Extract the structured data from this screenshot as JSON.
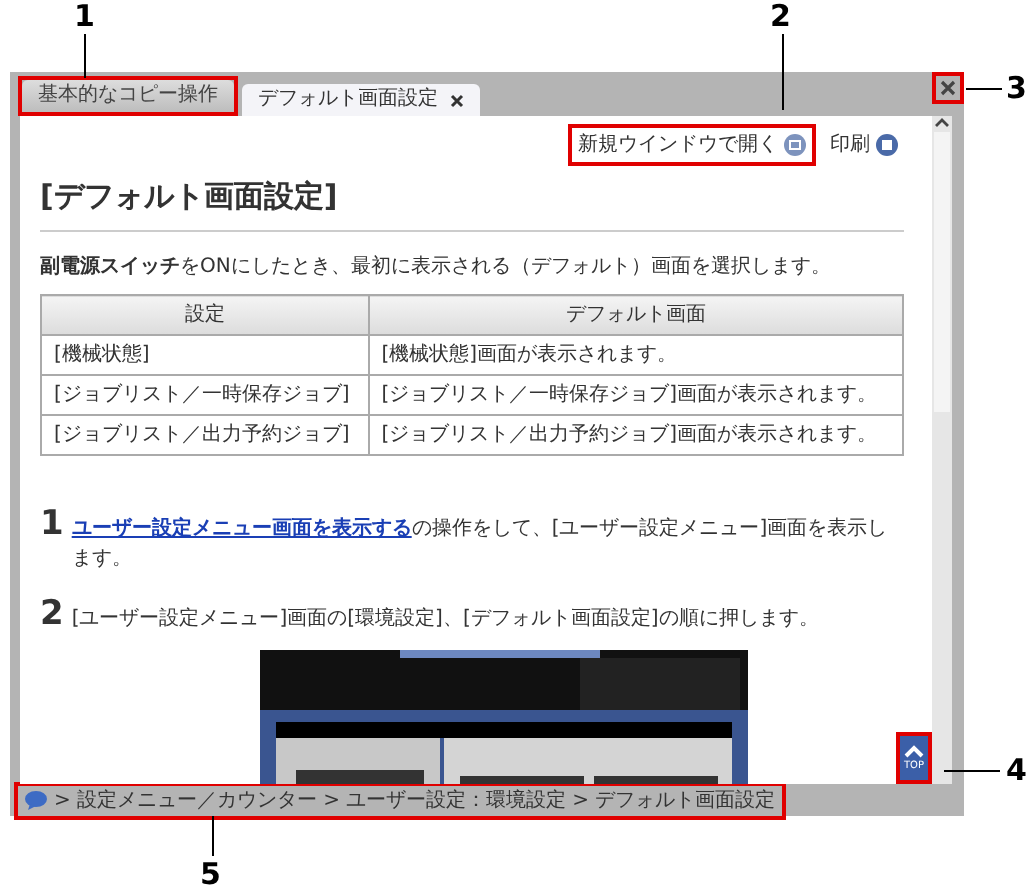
{
  "tabs": [
    {
      "label": "基本的なコピー操作",
      "selected": false,
      "highlighted": true
    },
    {
      "label": "デフォルト画面設定",
      "selected": true,
      "highlighted": false
    }
  ],
  "close_button": {
    "highlighted": true
  },
  "toolbar": [
    {
      "kind": "new-window",
      "label": "新規ウインドウで開く",
      "highlighted": true
    },
    {
      "kind": "print",
      "label": "印刷",
      "highlighted": false
    }
  ],
  "heading": "[デフォルト画面設定]",
  "intro": "**副電源スイッチ**をONにしたとき、最初に表示される（デフォルト）画面を選択します。",
  "table": {
    "columns": [
      "設定",
      "デフォルト画面"
    ],
    "rows": [
      [
        "[機械状態]",
        "[機械状態]画面が表示されます。"
      ],
      [
        "[ジョブリスト／一時保存ジョブ]",
        "[ジョブリスト／一時保存ジョブ]画面が表示されます。"
      ],
      [
        "[ジョブリスト／出力予約ジョブ]",
        "[ジョブリスト／出力予約ジョブ]画面が表示されます。"
      ]
    ]
  },
  "steps": [
    {
      "number": "1",
      "link": "ユーザー設定メニュー画面を表示する",
      "text": "の操作をして、[ユーザー設定メニュー]画面を表示します。"
    },
    {
      "number": "2",
      "text": "[ユーザー設定メニュー]画面の[環境設定]、[デフォルト画面設定]の順に押します。"
    }
  ],
  "top_button": {
    "label": "TOP",
    "highlighted": true
  },
  "breadcrumb": {
    "highlighted": true,
    "items": [
      "> 設定メニュー／カウンター",
      "> ユーザー設定：環境設定",
      "> デフォルト画面設定"
    ]
  },
  "callouts": [
    {
      "number": "1"
    },
    {
      "number": "2"
    },
    {
      "number": "3"
    },
    {
      "number": "4"
    },
    {
      "number": "5"
    }
  ]
}
